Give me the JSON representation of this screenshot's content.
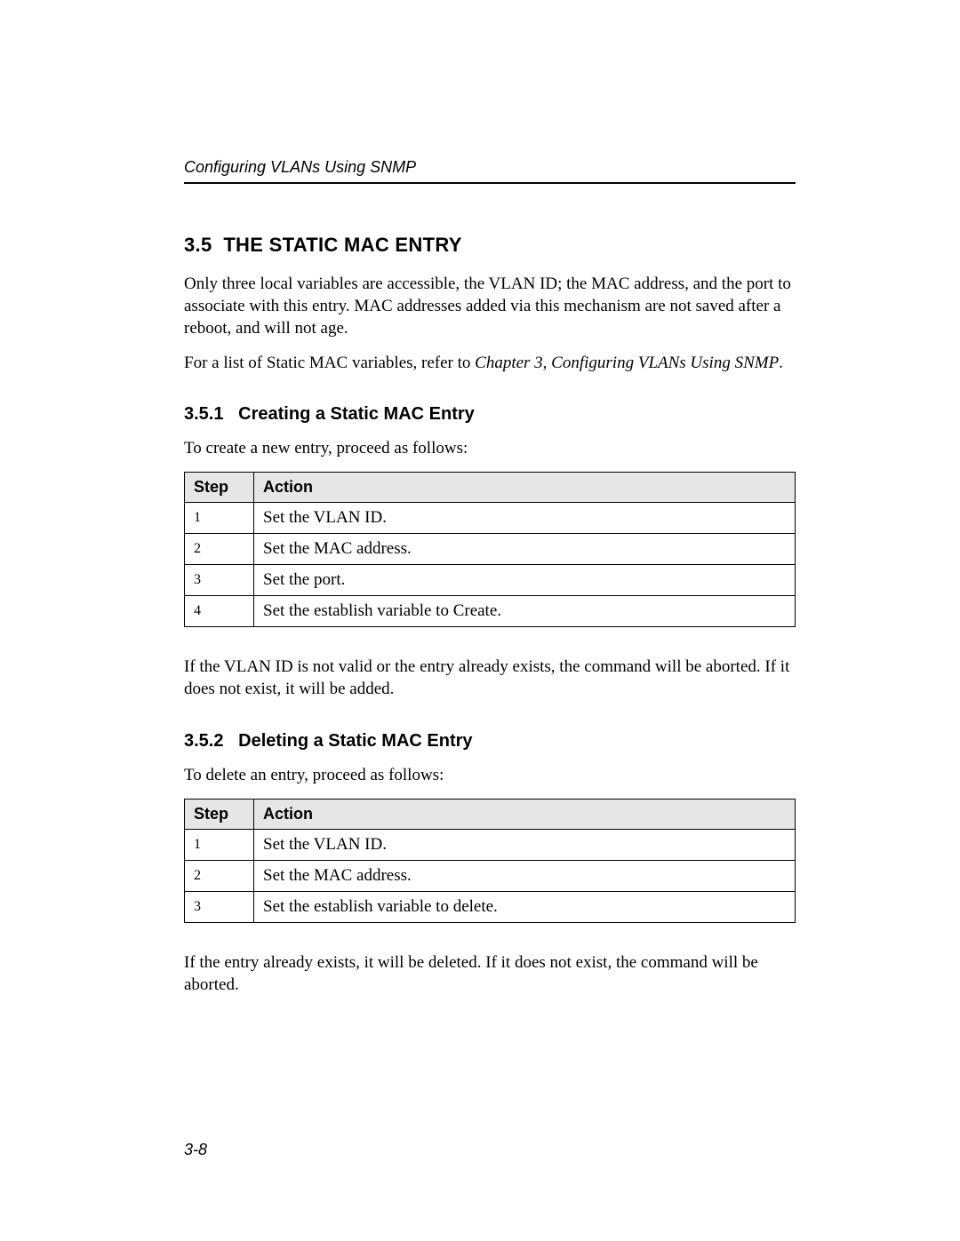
{
  "header": {
    "running_title": "Configuring VLANs Using SNMP"
  },
  "section35": {
    "number": "3.5",
    "title": "THE STATIC MAC ENTRY",
    "para1": "Only three local variables are accessible, the VLAN ID; the MAC address, and the port to associate with this entry. MAC addresses added via this mechanism are not saved after a reboot, and will not age.",
    "para2_pre": "For a list of Static MAC variables, refer to ",
    "para2_xref": "Chapter 3, Configuring VLANs Using SNMP",
    "para2_post": "."
  },
  "section351": {
    "number": "3.5.1",
    "title": "Creating a Static MAC Entry",
    "lead": "To create a new entry, proceed as follows:",
    "table": {
      "head_step": "Step",
      "head_action": "Action",
      "rows": [
        {
          "step": "1",
          "action": "Set the VLAN ID."
        },
        {
          "step": "2",
          "action": "Set the MAC address."
        },
        {
          "step": "3",
          "action": "Set the port."
        },
        {
          "step": "4",
          "action": "Set the establish variable to Create."
        }
      ]
    },
    "after": "If the VLAN ID is not valid or the entry already exists, the command will be aborted. If it does not exist, it will be added."
  },
  "section352": {
    "number": "3.5.2",
    "title": "Deleting a Static MAC Entry",
    "lead": "To delete an entry, proceed as follows:",
    "table": {
      "head_step": "Step",
      "head_action": "Action",
      "rows": [
        {
          "step": "1",
          "action": "Set the VLAN ID."
        },
        {
          "step": "2",
          "action": "Set the MAC address."
        },
        {
          "step": "3",
          "action": "Set the establish variable to delete."
        }
      ]
    },
    "after": "If the entry already exists, it will be deleted. If it does not exist, the command will be aborted."
  },
  "footer": {
    "page_number": "3-8"
  }
}
